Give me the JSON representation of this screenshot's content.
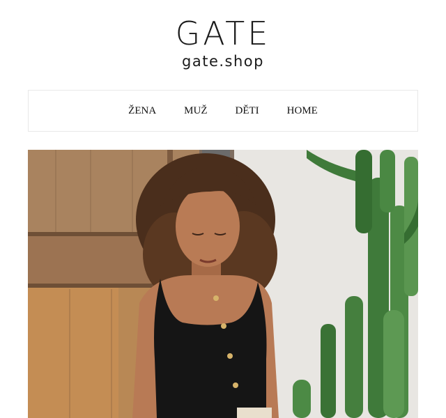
{
  "brand": {
    "logo_text": "GATE",
    "domain": "gate.shop"
  },
  "nav": {
    "items": [
      {
        "label": "ŽENA"
      },
      {
        "label": "MUŽ"
      },
      {
        "label": "DĚTI"
      },
      {
        "label": "HOME"
      }
    ]
  },
  "colors": {
    "wood": "#b4875a",
    "wall": "#ecebe8",
    "cactus": "#3f7a3a",
    "top": "#151515",
    "skin": "#b87a55",
    "hair": "#4a2e1c"
  }
}
